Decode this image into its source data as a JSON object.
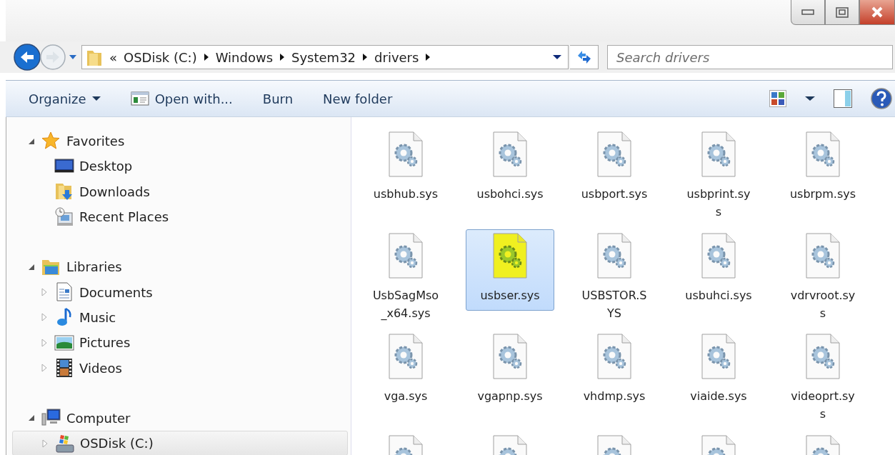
{
  "window": {
    "controls": [
      {
        "kind": "minimize"
      },
      {
        "kind": "maximize"
      },
      {
        "kind": "close"
      }
    ]
  },
  "navigation": {
    "back_enabled": true,
    "forward_enabled": false,
    "overflow": "«",
    "breadcrumb": [
      "OSDisk (C:)",
      "Windows",
      "System32",
      "drivers"
    ],
    "search": {
      "placeholder": "Search drivers"
    }
  },
  "toolbar": {
    "buttons": [
      {
        "label": "Organize",
        "kind": "dropdown"
      },
      {
        "label": "Open with...",
        "kind": "icon"
      },
      {
        "label": "Burn",
        "kind": "plain"
      },
      {
        "label": "New folder",
        "kind": "plain"
      }
    ]
  },
  "sidebar": {
    "groups": [
      {
        "label": "Favorites",
        "expanded": true,
        "selected": false,
        "children": [
          {
            "label": "Desktop",
            "expandable": false,
            "selected": false
          },
          {
            "label": "Downloads",
            "expandable": false,
            "selected": false
          },
          {
            "label": "Recent Places",
            "expandable": false,
            "selected": false
          }
        ]
      },
      {
        "label": "Libraries",
        "expanded": true,
        "selected": false,
        "children": [
          {
            "label": "Documents",
            "expandable": true,
            "selected": false
          },
          {
            "label": "Music",
            "expandable": true,
            "selected": false
          },
          {
            "label": "Pictures",
            "expandable": true,
            "selected": false
          },
          {
            "label": "Videos",
            "expandable": true,
            "selected": false
          }
        ]
      },
      {
        "label": "Computer",
        "expanded": true,
        "selected": false,
        "children": [
          {
            "label": "OSDisk (C:)",
            "expandable": true,
            "selected": true
          }
        ]
      }
    ]
  },
  "files": [
    {
      "name": "usbhub.sys",
      "selected": false,
      "highlighted": false
    },
    {
      "name": "usbohci.sys",
      "selected": false,
      "highlighted": false
    },
    {
      "name": "usbport.sys",
      "selected": false,
      "highlighted": false
    },
    {
      "name": "usbprint.sys",
      "selected": false,
      "highlighted": false
    },
    {
      "name": "usbrpm.sys",
      "selected": false,
      "highlighted": false
    },
    {
      "name": "UsbSagMso_x64.sys",
      "selected": false,
      "highlighted": false
    },
    {
      "name": "usbser.sys",
      "selected": true,
      "highlighted": true
    },
    {
      "name": "USBSTOR.SYS",
      "selected": false,
      "highlighted": false
    },
    {
      "name": "usbuhci.sys",
      "selected": false,
      "highlighted": false
    },
    {
      "name": "vdrvroot.sys",
      "selected": false,
      "highlighted": false
    },
    {
      "name": "vga.sys",
      "selected": false,
      "highlighted": false
    },
    {
      "name": "vgapnp.sys",
      "selected": false,
      "highlighted": false
    },
    {
      "name": "vhdmp.sys",
      "selected": false,
      "highlighted": false
    },
    {
      "name": "viaide.sys",
      "selected": false,
      "highlighted": false
    },
    {
      "name": "videoprt.sys",
      "selected": false,
      "highlighted": false
    },
    {
      "selected": false,
      "highlighted": false
    },
    {
      "selected": false,
      "highlighted": false
    },
    {
      "selected": false,
      "highlighted": false
    },
    {
      "selected": false,
      "highlighted": false
    },
    {
      "selected": false,
      "highlighted": false
    }
  ]
}
